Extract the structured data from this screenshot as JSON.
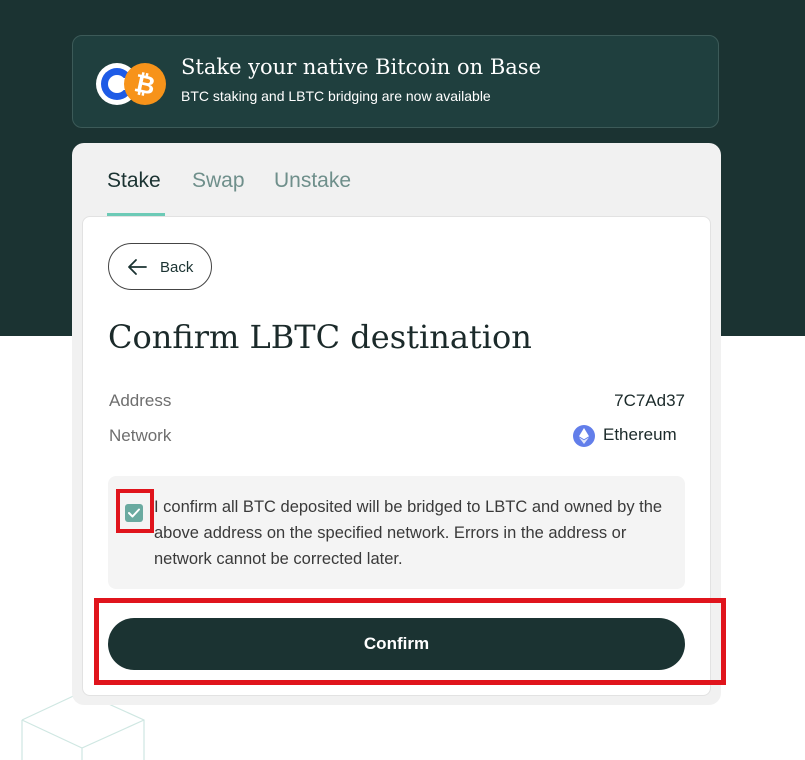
{
  "banner": {
    "title": "Stake your native Bitcoin on Base",
    "subtitle": "BTC staking and LBTC bridging are now available"
  },
  "tabs": [
    {
      "label": "Stake",
      "active": true
    },
    {
      "label": "Swap",
      "active": false
    },
    {
      "label": "Unstake",
      "active": false
    }
  ],
  "card": {
    "back_label": "Back",
    "title": "Confirm LBTC destination",
    "address_label": "Address",
    "address_value": "7C7Ad37",
    "network_label": "Network",
    "network_value": "Ethereum",
    "checkbox_checked": true,
    "notice_text": "I confirm all BTC deposited will be bridged to LBTC and owned by the above address on the specified network. Errors in the address or network cannot be corrected later.",
    "confirm_label": "Confirm"
  },
  "colors": {
    "hero_bg": "#1b3332",
    "accent": "#6ccab6",
    "button": "#1b3332",
    "highlight": "#e0141c",
    "bitcoin": "#f7931a",
    "ethereum": "#627eea"
  }
}
